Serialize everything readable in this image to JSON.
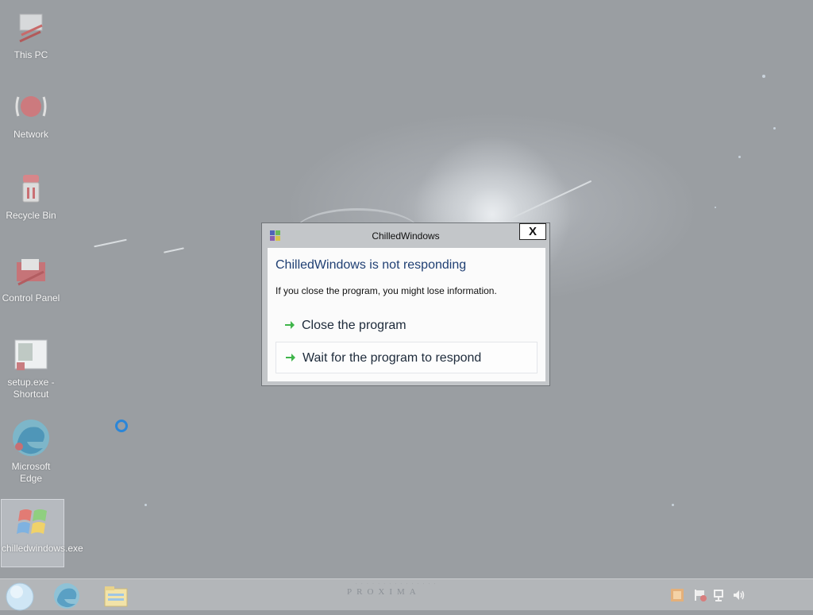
{
  "desktop": {
    "icons": [
      {
        "label": "This PC",
        "icon": "computer-icon"
      },
      {
        "label": "Network",
        "icon": "network-icon"
      },
      {
        "label": "Recycle Bin",
        "icon": "recycle-bin-icon"
      },
      {
        "label": "Control Panel",
        "icon": "control-panel-icon"
      },
      {
        "label": "setup.exe - Shortcut",
        "icon": "shortcut-icon"
      },
      {
        "label": "Microsoft Edge",
        "icon": "edge-icon"
      },
      {
        "label": "chilledwindows.exe",
        "icon": "windows-flag-icon"
      }
    ]
  },
  "dialog": {
    "title": "ChilledWindows",
    "close_label": "X",
    "heading": "ChilledWindows is not responding",
    "message": "If you close the program, you might lose information.",
    "options": [
      {
        "label": "Close the program"
      },
      {
        "label": "Wait for the program to respond"
      }
    ]
  },
  "taskbar": {
    "brand": "PROXIMA",
    "items": [
      "start-orb-icon",
      "edge-icon",
      "file-explorer-icon"
    ],
    "tray": [
      "app-tray-icon",
      "action-center-flag-icon",
      "network-tray-icon",
      "volume-icon"
    ]
  },
  "colors": {
    "heading": "#1f3f73",
    "arrow": "#3fb54a",
    "desktop": "#9b9fa3"
  }
}
